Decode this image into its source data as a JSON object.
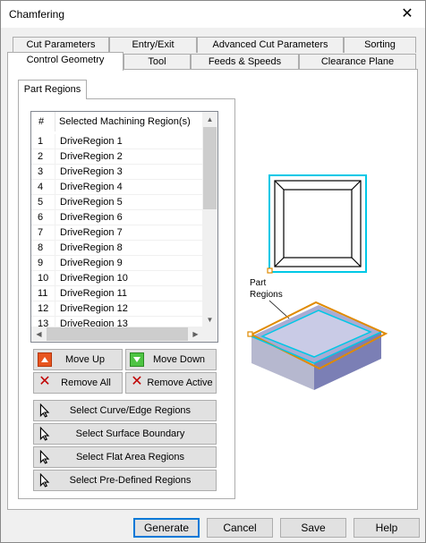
{
  "window": {
    "title": "Chamfering",
    "close_glyph": "✕"
  },
  "tabs_row1": [
    "Cut Parameters",
    "Entry/Exit",
    "Advanced Cut Parameters",
    "Sorting"
  ],
  "tabs_row2": [
    "Control Geometry",
    "Tool",
    "Feeds & Speeds",
    "Clearance Plane"
  ],
  "active_tab": "Control Geometry",
  "inner_tab": "Part Regions",
  "list": {
    "col_num": "#",
    "col_name": "Selected Machining Region(s)",
    "rows": [
      {
        "n": "1",
        "name": "DriveRegion 1"
      },
      {
        "n": "2",
        "name": "DriveRegion 2"
      },
      {
        "n": "3",
        "name": "DriveRegion 3"
      },
      {
        "n": "4",
        "name": "DriveRegion 4"
      },
      {
        "n": "5",
        "name": "DriveRegion 5"
      },
      {
        "n": "6",
        "name": "DriveRegion 6"
      },
      {
        "n": "7",
        "name": "DriveRegion 7"
      },
      {
        "n": "8",
        "name": "DriveRegion 8"
      },
      {
        "n": "9",
        "name": "DriveRegion 9"
      },
      {
        "n": "10",
        "name": "DriveRegion 10"
      },
      {
        "n": "11",
        "name": "DriveRegion 11"
      },
      {
        "n": "12",
        "name": "DriveRegion 12"
      },
      {
        "n": "13",
        "name": "DriveRegion 13"
      }
    ]
  },
  "buttons": {
    "move_up": "Move Up",
    "move_down": "Move Down",
    "remove_all": "Remove All",
    "remove_active": "Remove Active",
    "select_curve": "Select Curve/Edge Regions",
    "select_surface": "Select Surface Boundary",
    "select_flat": "Select Flat Area Regions",
    "select_predefined": "Select Pre-Defined Regions"
  },
  "illustration": {
    "label_line1": "Part",
    "label_line2": "Regions",
    "colors": {
      "cyan": "#00c8e6",
      "orange": "#e08a00",
      "block_top": "#a9abd3",
      "block_side": "#7b7fb5"
    }
  },
  "footer": {
    "generate": "Generate",
    "cancel": "Cancel",
    "save": "Save",
    "help": "Help"
  },
  "colors": {
    "accent": "#0078d7",
    "button_face": "#e1e1e1",
    "window_bg": "#f0f0f0"
  }
}
